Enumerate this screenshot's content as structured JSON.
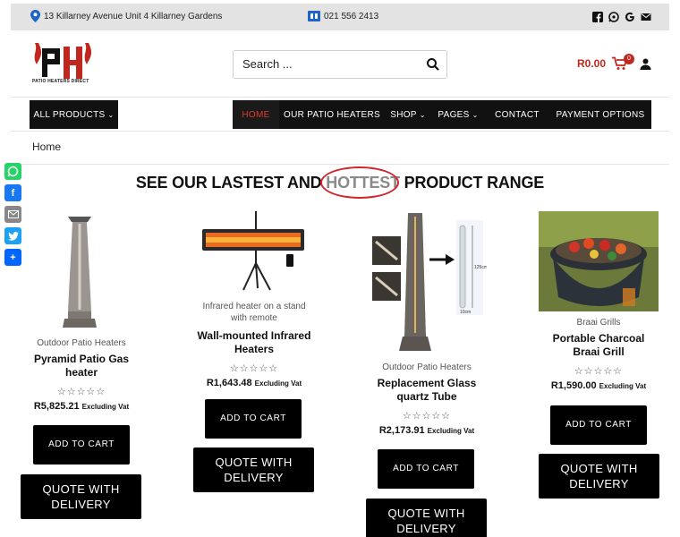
{
  "topbar": {
    "address": "13 Killarney Avenue Unit 4 Killarney Gardens",
    "phone": "021 556 2413",
    "social_icons": [
      "facebook-icon",
      "whatsapp-icon",
      "google-icon",
      "email-icon"
    ]
  },
  "brand": {
    "logo_text": "PATIO HEATERS DIRECT",
    "accent": "#c0281f"
  },
  "search": {
    "placeholder": "Search ..."
  },
  "cart": {
    "total": "R0.00",
    "count": "0"
  },
  "nav": {
    "all_products": "ALL PRODUCTS",
    "items": [
      {
        "label": "HOME"
      },
      {
        "label": "OUR PATIO HEATERS"
      },
      {
        "label": "SHOP"
      },
      {
        "label": "PAGES"
      },
      {
        "label": "CONTACT"
      },
      {
        "label": "PAYMENT OPTIONS"
      }
    ]
  },
  "breadcrumb": {
    "home": "Home"
  },
  "share_icons": [
    "whatsapp-icon",
    "facebook-icon",
    "email-icon",
    "twitter-icon",
    "share-icon"
  ],
  "headline": {
    "before": "SEE OUR LASTEST AND ",
    "highlight": "HOTTEST",
    "after": " PRODUCT RANGE"
  },
  "products": [
    {
      "category": "Outdoor Patio Heaters",
      "title": "Pyramid Patio Gas heater",
      "rating": 0,
      "price": "R5,825.21",
      "price_note": "Excluding Vat",
      "add_to_cart": "ADD TO CART",
      "quote": "QUOTE WITH DELIVERY"
    },
    {
      "category": "Infrared heater on a stand with remote",
      "title": "Wall-mounted Infrared Heaters",
      "rating": 0,
      "price": "R1,643.48",
      "price_note": "Excluding Vat",
      "add_to_cart": "ADD TO CART",
      "quote": "QUOTE WITH DELIVERY"
    },
    {
      "category": "Outdoor Patio Heaters",
      "title": "Replacement Glass quartz Tube",
      "rating": 0,
      "price": "R2,173.91",
      "price_note": "Excluding Vat",
      "add_to_cart": "ADD TO CART",
      "quote": "QUOTE WITH DELIVERY",
      "image_labels": [
        "125cm",
        "10cm"
      ]
    },
    {
      "category": "Braai Grills",
      "title": "Portable Charcoal Braai Grill",
      "rating": 0,
      "price": "R1,590.00",
      "price_note": "Excluding Vat",
      "add_to_cart": "ADD TO CART",
      "quote": "QUOTE WITH DELIVERY"
    }
  ]
}
